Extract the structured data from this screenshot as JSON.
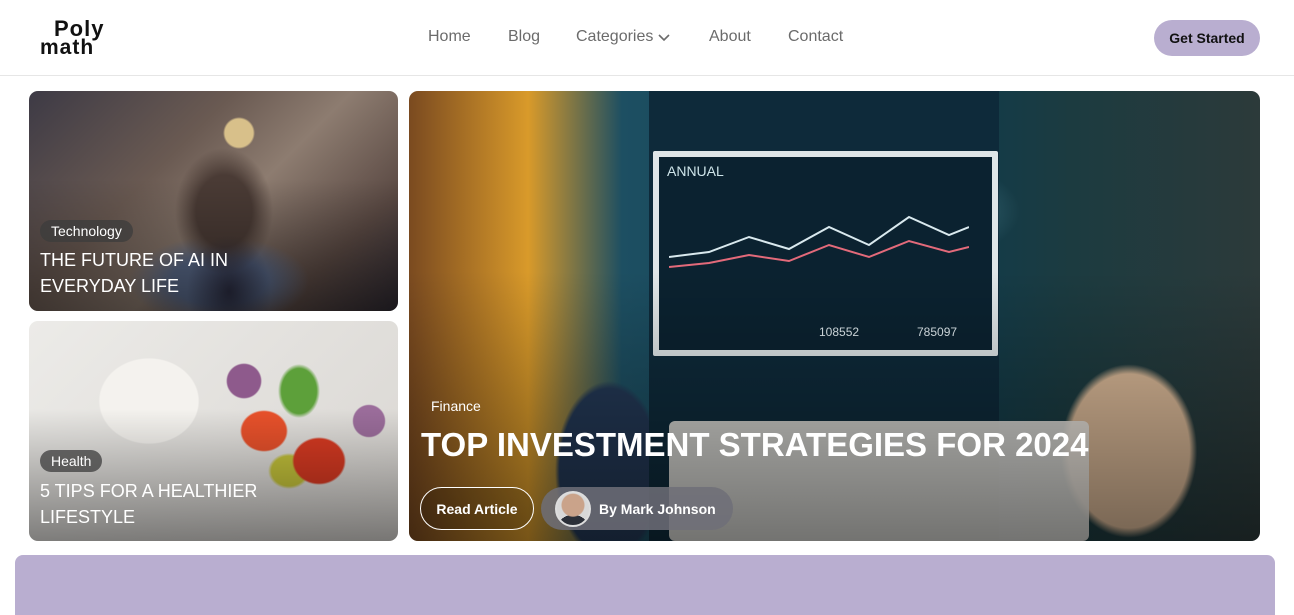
{
  "logo": {
    "line1": "Poly",
    "line2": "math"
  },
  "nav": {
    "items": [
      "Home",
      "Blog",
      "Categories",
      "About",
      "Contact"
    ]
  },
  "cta": {
    "label": "Get Started"
  },
  "cards": {
    "ai": {
      "tag": "Technology",
      "title": "The Future of AI in Everyday Life"
    },
    "health": {
      "tag": "Health",
      "title": "5 Tips for a Healthier Lifestyle"
    },
    "featured": {
      "tag": "Finance",
      "title": "Top Investment Strategies for 2024",
      "read_label": "Read Article",
      "author": "By Mark Johnson",
      "screen": {
        "title": "ANNUAL",
        "balance": "108552",
        "summary": "785097"
      }
    }
  },
  "colors": {
    "accent": "#b9aed0",
    "nav_text": "#6b6b6b"
  }
}
